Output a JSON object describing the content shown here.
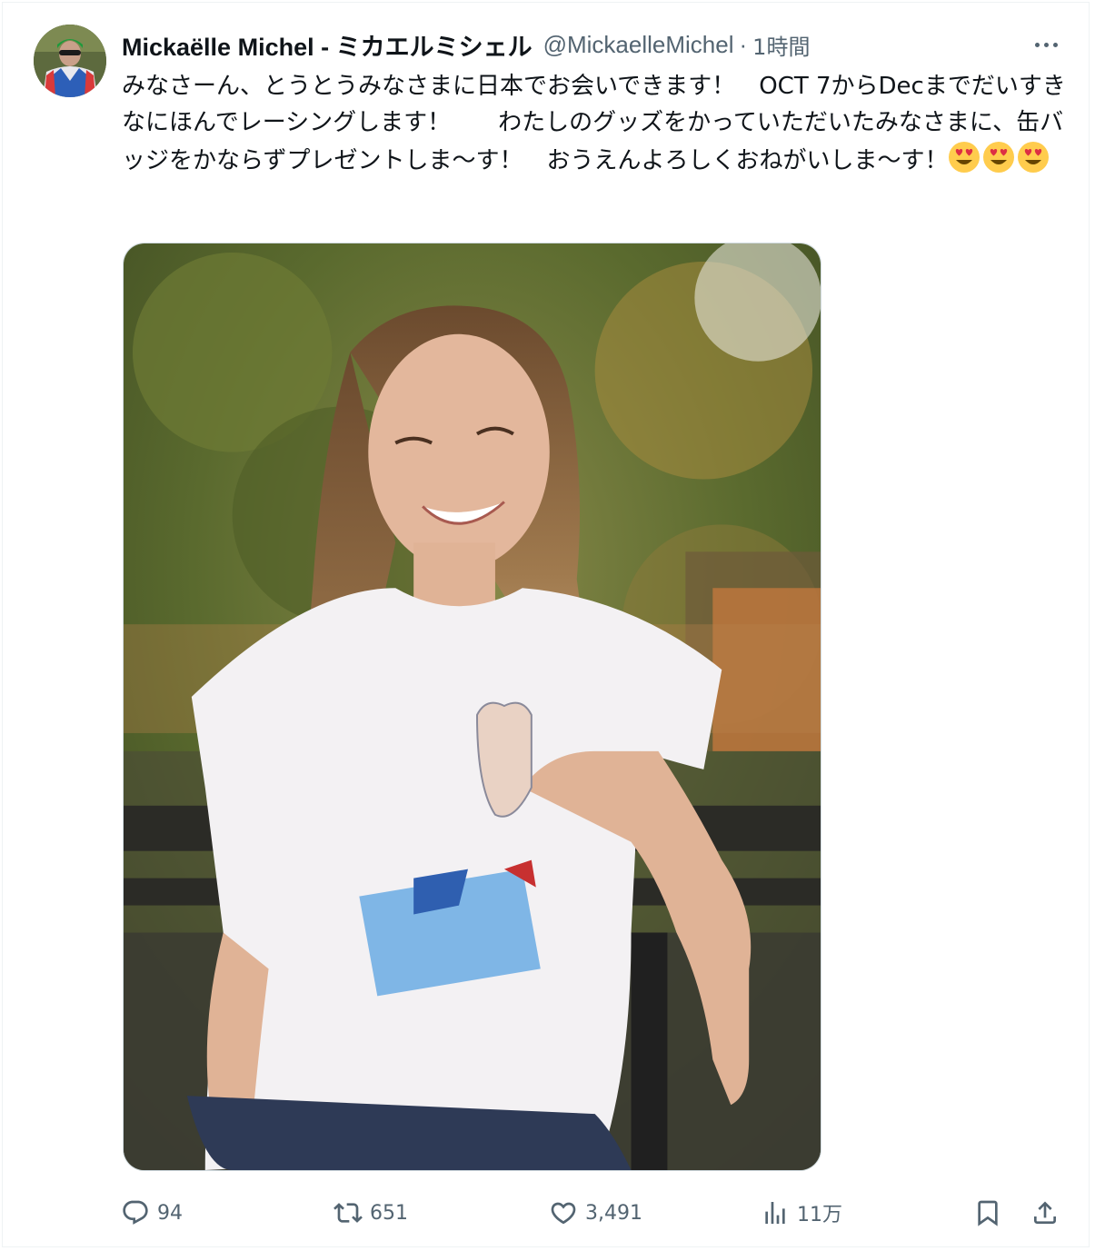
{
  "author": {
    "display_name": "Mickaëlle Michel - ミカエルミシェル",
    "handle": "@MickaelleMichel",
    "separator": "·",
    "time": "1時間"
  },
  "tweet": {
    "text": "みなさーん、とうとうみなさまに日本でお会いできます！　OCT 7からDecまでだいすきなにほんでレーシングします！　　わたしのグッズをかっていただいたみなさまに、缶バッジをかならずプレゼントしま～す！　おうえんよろしくおねがいしま～す！",
    "emojis": [
      "smiling-face-with-heart-eyes",
      "smiling-face-with-heart-eyes",
      "smiling-face-with-heart-eyes"
    ]
  },
  "actions": {
    "reply": {
      "icon": "reply-icon",
      "count": "94"
    },
    "retweet": {
      "icon": "retweet-icon",
      "count": "651"
    },
    "like": {
      "icon": "heart-icon",
      "count": "3,491"
    },
    "views": {
      "icon": "analytics-icon",
      "count": "11万"
    },
    "bookmark": {
      "icon": "bookmark-icon"
    },
    "share": {
      "icon": "share-icon"
    }
  },
  "colors": {
    "text_primary": "#0f1419",
    "text_secondary": "#536471",
    "border": "#cfd9de"
  }
}
